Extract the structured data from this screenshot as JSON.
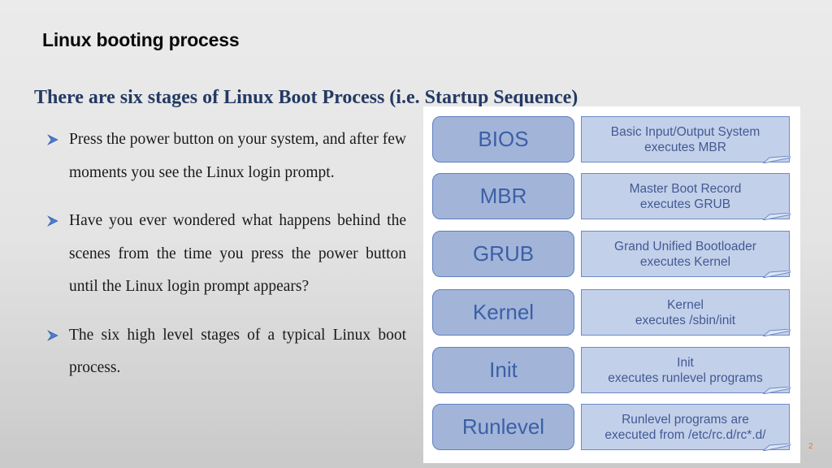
{
  "slide": {
    "title": "Linux booting process",
    "subtitle": "There are six stages of Linux Boot Process (i.e. Startup Sequence)",
    "page_number": "2"
  },
  "bullets": [
    {
      "icon": "arrowhead-bullet-icon",
      "text": "Press the power button on your system, and after few moments you see the Linux login prompt."
    },
    {
      "icon": "arrowhead-bullet-icon",
      "text": "Have you ever wondered what happens behind the scenes from the time you press the power button until the Linux login prompt appears?"
    },
    {
      "icon": "arrowhead-bullet-icon",
      "text": "The six high level stages of a typical Linux boot process."
    }
  ],
  "diagram": {
    "stages": [
      {
        "name": "BIOS",
        "line1": "Basic Input/Output System",
        "line2": "executes MBR"
      },
      {
        "name": "MBR",
        "line1": "Master Boot Record",
        "line2": "executes GRUB"
      },
      {
        "name": "GRUB",
        "line1": "Grand Unified Bootloader",
        "line2": "executes Kernel"
      },
      {
        "name": "Kernel",
        "line1": "Kernel",
        "line2": "executes /sbin/init"
      },
      {
        "name": "Init",
        "line1": "Init",
        "line2": "executes runlevel programs"
      },
      {
        "name": "Runlevel",
        "line1": "Runlevel programs are",
        "line2": "executed from /etc/rc.d/rc*.d/"
      }
    ],
    "colors": {
      "stage_fill": "#a2b5d9",
      "stage_border": "#5f7fbf",
      "stage_text": "#3c5fa6",
      "note_fill": "#c3d0ea",
      "note_text": "#425a93"
    }
  }
}
